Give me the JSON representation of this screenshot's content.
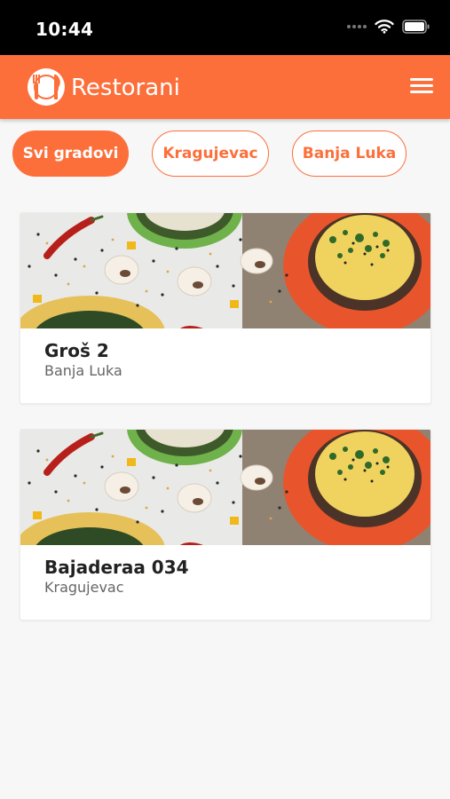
{
  "status_bar": {
    "time": "10:44",
    "icons": [
      "signal-dots-icon",
      "wifi-icon",
      "battery-icon"
    ]
  },
  "header": {
    "title": "Restorani",
    "logo_icon": "plate-cutlery-icon",
    "menu_icon": "hamburger-menu-icon"
  },
  "filters": [
    {
      "label": "Svi gradovi",
      "selected": true
    },
    {
      "label": "Kragujevac",
      "selected": false
    },
    {
      "label": "Banja Luka",
      "selected": false
    }
  ],
  "restaurants": [
    {
      "name": "Groš 2",
      "city": "Banja Luka",
      "image": "food-photo-soups-mushrooms-peppers"
    },
    {
      "name": "Bajaderaa 034",
      "city": "Kragujevac",
      "image": "food-photo-soups-mushrooms-peppers"
    }
  ],
  "colors": {
    "accent": "#fc6f3b",
    "status_bar": "#000000",
    "background": "#f7f7f7",
    "card": "#ffffff",
    "text_primary": "#222222",
    "text_secondary": "#666666"
  }
}
